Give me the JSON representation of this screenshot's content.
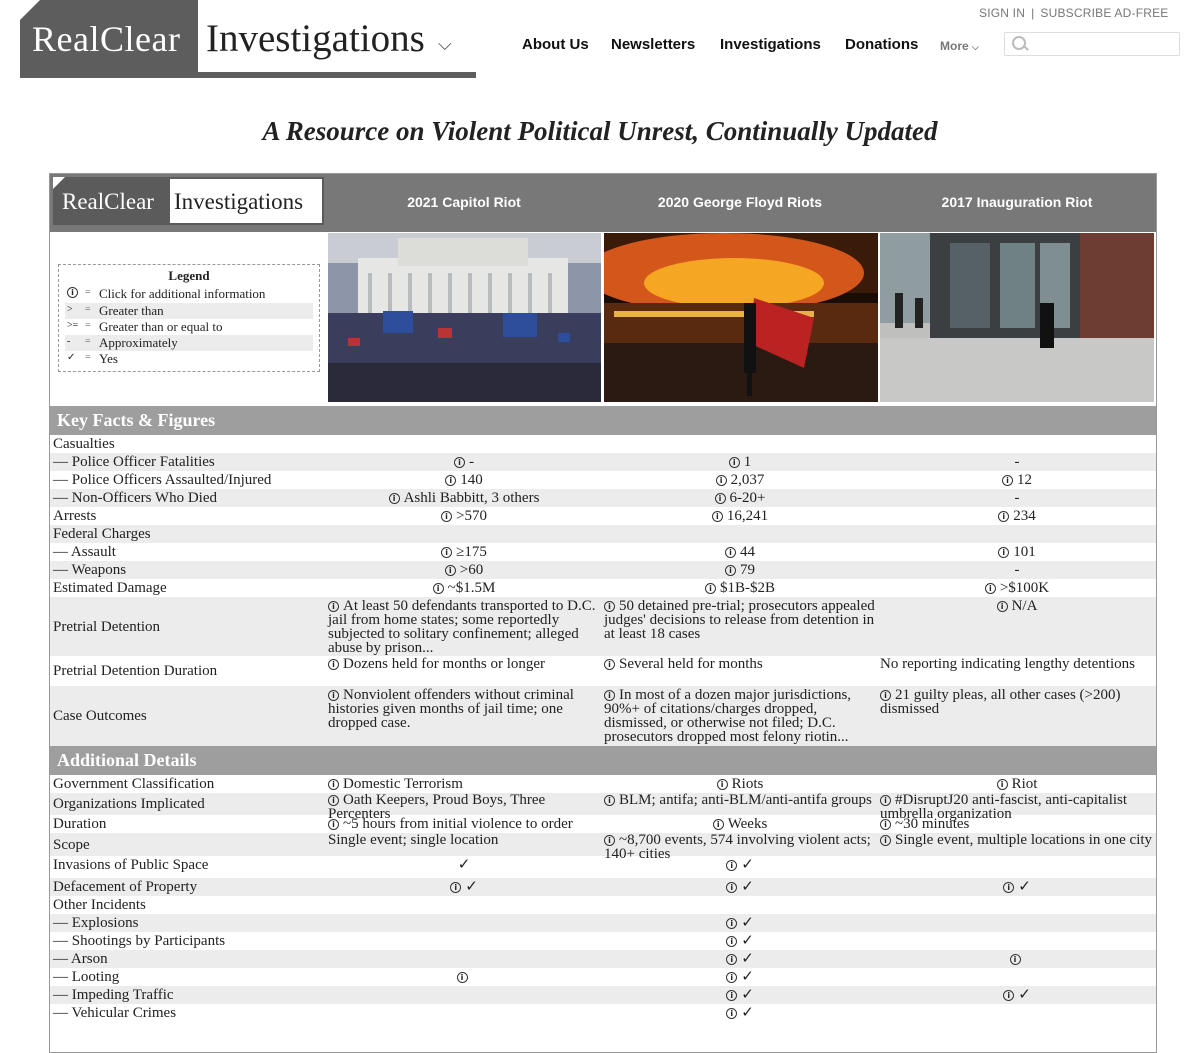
{
  "site": {
    "logo_left": "RealClear",
    "logo_right": "Investigations",
    "nav": [
      "About Us",
      "Newsletters",
      "Investigations",
      "Donations"
    ],
    "more_label": "More",
    "sign_in": "SIGN IN",
    "subscribe": "SUBSCRIBE AD-FREE",
    "search_placeholder": ""
  },
  "page_title": "A Resource on Violent Political Unrest, Continually Updated",
  "table": {
    "logo_left": "RealClear",
    "logo_right": "Investigations",
    "columns": [
      "2021 Capitol Riot",
      "2020 George Floyd Riots",
      "2017 Inauguration Riot"
    ],
    "legend": {
      "title": "Legend",
      "items": [
        {
          "symbol": "i",
          "eq": "=",
          "text": "Click for additional information"
        },
        {
          "symbol": ">",
          "eq": "=",
          "text": "Greater than"
        },
        {
          "symbol": ">=",
          "eq": "=",
          "text": "Greater than or equal to"
        },
        {
          "symbol": "-",
          "eq": "=",
          "text": "Approximately"
        },
        {
          "symbol": "✓",
          "eq": "=",
          "text": "Yes"
        }
      ]
    },
    "sections": [
      {
        "title": "Key Facts & Figures",
        "rows": [
          {
            "label": "Casualties",
            "cells": [
              null,
              null,
              null
            ]
          },
          {
            "label": "— Police Officer Fatalities",
            "cells": [
              {
                "info": true,
                "text": "-",
                "align": "c"
              },
              {
                "info": true,
                "text": "1",
                "align": "c"
              },
              {
                "info": false,
                "text": "-",
                "align": "c"
              }
            ]
          },
          {
            "label": "— Police Officers Assaulted/Injured",
            "cells": [
              {
                "info": true,
                "text": "140",
                "align": "c"
              },
              {
                "info": true,
                "text": "2,037",
                "align": "c"
              },
              {
                "info": true,
                "text": "12",
                "align": "c"
              }
            ]
          },
          {
            "label": "— Non-Officers Who Died",
            "cells": [
              {
                "info": true,
                "text": "Ashli Babbitt, 3 others",
                "align": "c"
              },
              {
                "info": true,
                "text": "6-20+",
                "align": "c"
              },
              {
                "info": false,
                "text": "-",
                "align": "c"
              }
            ]
          },
          {
            "label": "Arrests",
            "cells": [
              {
                "info": true,
                "text": ">570",
                "align": "c"
              },
              {
                "info": true,
                "text": "16,241",
                "align": "c"
              },
              {
                "info": true,
                "text": "234",
                "align": "c"
              }
            ]
          },
          {
            "label": "Federal Charges",
            "cells": [
              null,
              null,
              null
            ]
          },
          {
            "label": "— Assault",
            "cells": [
              {
                "info": true,
                "text": "≥175",
                "align": "c"
              },
              {
                "info": true,
                "text": "44",
                "align": "c"
              },
              {
                "info": true,
                "text": "101",
                "align": "c"
              }
            ]
          },
          {
            "label": "— Weapons",
            "cells": [
              {
                "info": true,
                "text": ">60",
                "align": "c"
              },
              {
                "info": true,
                "text": "79",
                "align": "c"
              },
              {
                "info": false,
                "text": "-",
                "align": "c"
              }
            ]
          },
          {
            "label": "Estimated Damage",
            "cells": [
              {
                "info": true,
                "text": "~$1.5M",
                "align": "c"
              },
              {
                "info": true,
                "text": "$1B-$2B",
                "align": "c"
              },
              {
                "info": true,
                "text": ">$100K",
                "align": "c"
              }
            ]
          },
          {
            "label": "Pretrial Detention",
            "cells": [
              {
                "info": true,
                "text": "At least 50 defendants transported to D.C. jail from home states; some reportedly subjected to solitary confinement; alleged abuse by prison...",
                "align": "l"
              },
              {
                "info": true,
                "text": "50 detained pre-trial; prosecutors appealed judges' decisions to release from detention in at least 18 cases",
                "align": "l"
              },
              {
                "info": true,
                "text": "N/A",
                "align": "c"
              }
            ]
          },
          {
            "label": "Pretrial Detention Duration",
            "cells": [
              {
                "info": true,
                "text": "Dozens held for months or longer",
                "align": "l"
              },
              {
                "info": true,
                "text": "Several held for months",
                "align": "l"
              },
              {
                "info": false,
                "text": "No reporting indicating lengthy detentions",
                "align": "l"
              }
            ]
          },
          {
            "label": "Case Outcomes",
            "cells": [
              {
                "info": true,
                "text": "Nonviolent offenders without criminal histories given months of jail time; one dropped case.",
                "align": "l"
              },
              {
                "info": true,
                "text": "In most of a dozen major jurisdictions, 90%+ of citations/charges dropped, dismissed, or otherwise not filed; D.C. prosecutors dropped most felony riotin...",
                "align": "l"
              },
              {
                "info": true,
                "text": "21 guilty pleas, all other cases (>200) dismissed",
                "align": "l"
              }
            ]
          }
        ]
      },
      {
        "title": "Additional Details",
        "rows": [
          {
            "label": "Government Classification",
            "cells": [
              {
                "info": true,
                "text": "Domestic Terrorism",
                "align": "l"
              },
              {
                "info": true,
                "text": "Riots",
                "align": "c"
              },
              {
                "info": true,
                "text": "Riot",
                "align": "c"
              }
            ]
          },
          {
            "label": "Organizations Implicated",
            "cells": [
              {
                "info": true,
                "text": "Oath Keepers, Proud Boys, Three Percenters",
                "align": "l"
              },
              {
                "info": true,
                "text": "BLM; antifa; anti-BLM/anti-antifa groups",
                "align": "l"
              },
              {
                "info": true,
                "text": "#DisruptJ20 anti-fascist, anti-capitalist umbrella organization",
                "align": "l"
              }
            ]
          },
          {
            "label": "Duration",
            "cells": [
              {
                "info": true,
                "text": "~5 hours from initial violence to order",
                "align": "l"
              },
              {
                "info": true,
                "text": "Weeks",
                "align": "c"
              },
              {
                "info": true,
                "text": "~30 minutes",
                "align": "l"
              }
            ]
          },
          {
            "label": "Scope",
            "cells": [
              {
                "info": false,
                "text": "Single event; single location",
                "align": "l"
              },
              {
                "info": true,
                "text": "~8,700 events, 574 involving violent acts; 140+ cities",
                "align": "l"
              },
              {
                "info": true,
                "text": "Single event, multiple locations in one city",
                "align": "l"
              }
            ]
          },
          {
            "label": "Invasions of Public Space",
            "cells": [
              {
                "info": false,
                "text": "✓",
                "align": "c"
              },
              {
                "info": true,
                "text": "✓",
                "align": "c"
              },
              null
            ]
          },
          {
            "label": "Defacement of Property",
            "cells": [
              {
                "info": true,
                "text": "✓",
                "align": "c"
              },
              {
                "info": true,
                "text": "✓",
                "align": "c"
              },
              {
                "info": true,
                "text": "✓",
                "align": "c"
              }
            ]
          },
          {
            "label": "Other Incidents",
            "cells": [
              null,
              null,
              null
            ]
          },
          {
            "label": "— Explosions",
            "cells": [
              null,
              {
                "info": true,
                "text": "✓",
                "align": "c"
              },
              null
            ]
          },
          {
            "label": "— Shootings by Participants",
            "cells": [
              null,
              {
                "info": true,
                "text": "✓",
                "align": "c"
              },
              null
            ]
          },
          {
            "label": "— Arson",
            "cells": [
              null,
              {
                "info": true,
                "text": "✓",
                "align": "c"
              },
              {
                "info": true,
                "text": "",
                "align": "c"
              }
            ]
          },
          {
            "label": "— Looting",
            "cells": [
              {
                "info": true,
                "text": "",
                "align": "c"
              },
              {
                "info": true,
                "text": "✓",
                "align": "c"
              },
              null
            ]
          },
          {
            "label": "— Impeding Traffic",
            "cells": [
              null,
              {
                "info": true,
                "text": "✓",
                "align": "c"
              },
              {
                "info": true,
                "text": "✓",
                "align": "c"
              }
            ]
          },
          {
            "label": "— Vehicular Crimes",
            "cells": [
              null,
              {
                "info": true,
                "text": "✓",
                "align": "c"
              },
              null
            ]
          }
        ]
      }
    ]
  },
  "colors": {
    "header_gray": "#787878",
    "section_gray": "#9e9e9e",
    "row_shade": "#ececec",
    "logo_dark": "#5d5d5d"
  }
}
